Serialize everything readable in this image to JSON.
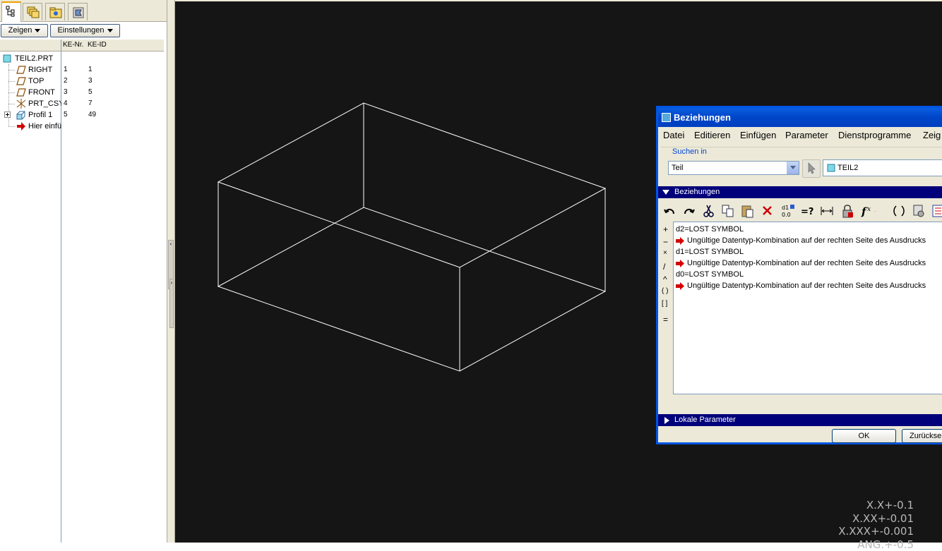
{
  "left_panel": {
    "tabs": [
      {
        "name": "model-tree-tab-icon"
      },
      {
        "name": "layers-tab-icon"
      },
      {
        "name": "folder-browser-tab-icon"
      },
      {
        "name": "favorites-tab-icon"
      }
    ],
    "show_button": "Zeigen",
    "settings_button": "Einstellungen",
    "columns": {
      "nr": "KE-Nr.",
      "id": "KE-ID"
    },
    "tree": [
      {
        "label": "TEIL2.PRT",
        "nr": "",
        "id": "",
        "icon": "part-icon"
      },
      {
        "label": "RIGHT",
        "nr": "1",
        "id": "1",
        "icon": "datum-plane-icon"
      },
      {
        "label": "TOP",
        "nr": "2",
        "id": "3",
        "icon": "datum-plane-icon"
      },
      {
        "label": "FRONT",
        "nr": "3",
        "id": "5",
        "icon": "datum-plane-icon"
      },
      {
        "label": "PRT_CSY",
        "nr": "4",
        "id": "7",
        "icon": "coordinate-system-icon"
      },
      {
        "label": "Profil 1",
        "nr": "5",
        "id": "49",
        "icon": "extrude-icon"
      },
      {
        "label": "Hier einfü",
        "nr": "",
        "id": "",
        "icon": "insert-here-arrow-icon"
      }
    ]
  },
  "viewport": {
    "tolerances": [
      "X.X+-0.1",
      "X.XX+-0.01",
      "X.XXX+-0.001",
      "ANG.+-0.5"
    ]
  },
  "dialog": {
    "title": "Beziehungen",
    "menu": [
      "Datei",
      "Editieren",
      "Einfügen",
      "Parameter",
      "Dienstprogramme",
      "Zeig"
    ],
    "search_caption": "Suchen in",
    "search_type": "Teil",
    "search_object": "TEIL2",
    "relations_section": "Beziehungen",
    "operators": [
      "+",
      "−",
      "×",
      "/",
      "^",
      "( )",
      "[ ]",
      "="
    ],
    "toolbar_icons": [
      "undo-icon",
      "redo-icon",
      "cut-icon",
      "copy-icon",
      "paste-icon",
      "delete-icon",
      "switch-dimensions-icon",
      "evaluate-icon",
      "show-dimension-icon",
      "lock-icon",
      "function-icon",
      "parentheses-icon",
      "verify-icon",
      "sort-icon"
    ],
    "relations": [
      {
        "text": "d2=LOST SYMBOL",
        "type": "relation"
      },
      {
        "text": "Ungültige Datentyp-Kombination auf der rechten Seite des Ausdrucks",
        "type": "error"
      },
      {
        "text": "d1=LOST SYMBOL",
        "type": "relation"
      },
      {
        "text": "Ungültige Datentyp-Kombination auf der rechten Seite des Ausdrucks",
        "type": "error"
      },
      {
        "text": "d0=LOST SYMBOL",
        "type": "relation"
      },
      {
        "text": "Ungültige Datentyp-Kombination auf der rechten Seite des Ausdrucks",
        "type": "error"
      }
    ],
    "local_params_section": "Lokale Parameter",
    "ok_button": "OK",
    "reset_button": "Zurückse"
  },
  "colors": {
    "viewport_bg": "#151515",
    "wireframe": "#ffffff",
    "dialog_title": "#0a5ee0",
    "section_bar": "#00007b",
    "error_arrow": "#d40000"
  }
}
